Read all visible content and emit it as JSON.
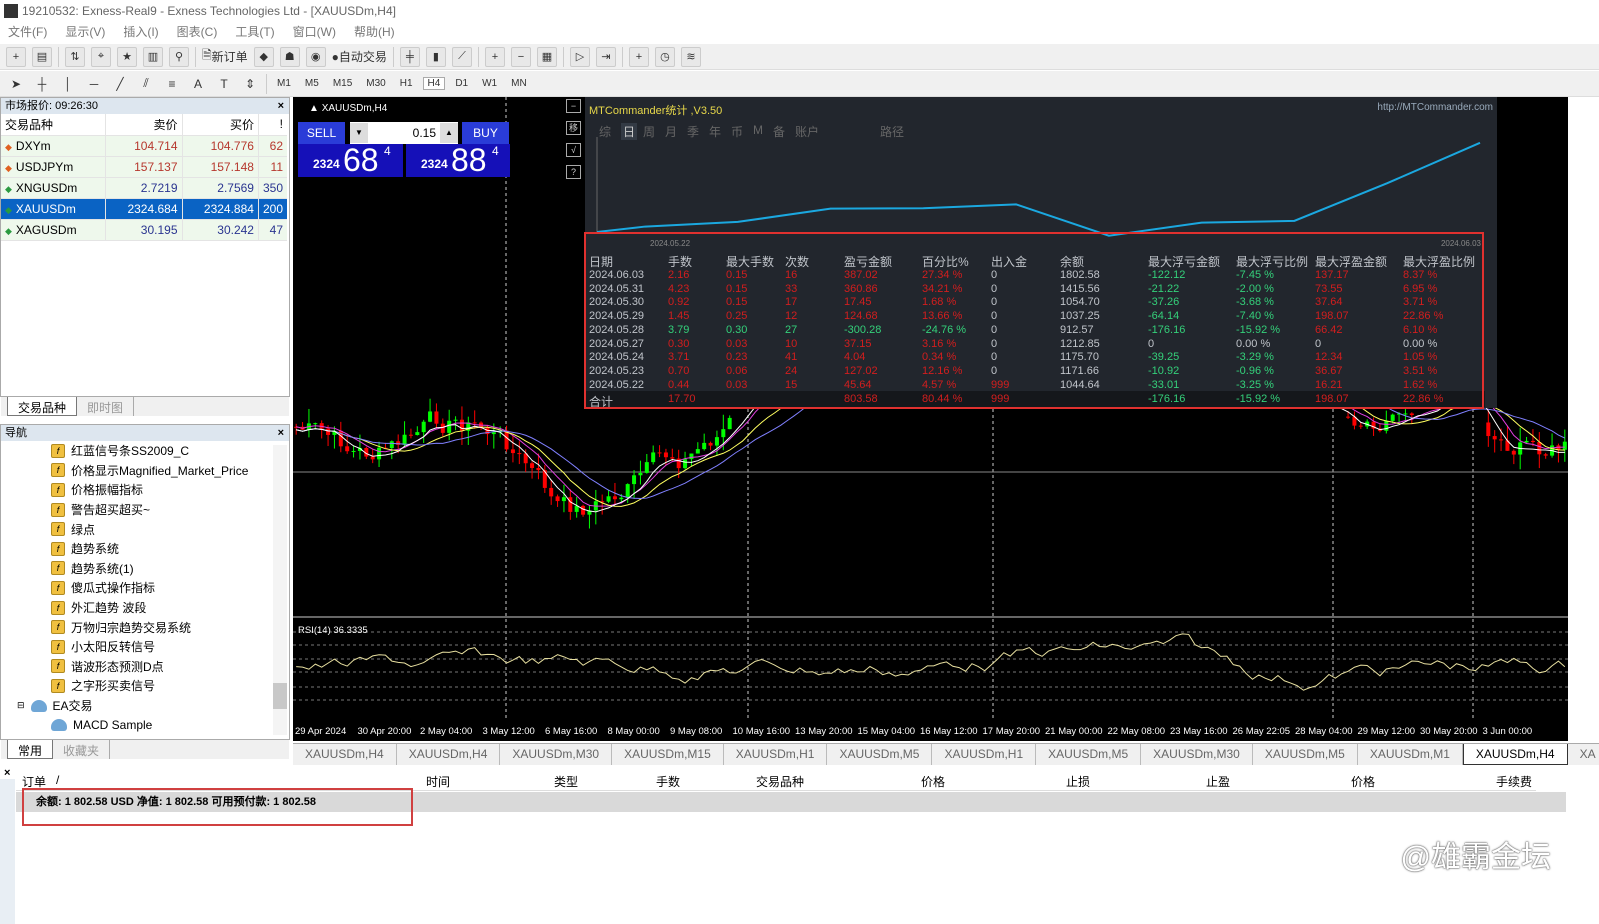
{
  "window": {
    "title": "19210532: Exness-Real9 - Exness Technologies Ltd - [XAUUSDm,H4]"
  },
  "menu": [
    "文件(F)",
    "显示(V)",
    "插入(I)",
    "图表(C)",
    "工具(T)",
    "窗口(W)",
    "帮助(H)"
  ],
  "toolbar": {
    "new_order": "新订单",
    "auto_trade": "自动交易"
  },
  "timeframes": [
    "M1",
    "M5",
    "M15",
    "M30",
    "H1",
    "H4",
    "D1",
    "W1",
    "MN"
  ],
  "active_timeframe": "H4",
  "market_watch": {
    "title": "市场报价: 09:26:30",
    "headers": [
      "交易品种",
      "卖价",
      "买价",
      "!"
    ],
    "rows": [
      {
        "symbol": "DXYm",
        "bid": "104.714",
        "ask": "104.776",
        "spread": "62",
        "dir": "down"
      },
      {
        "symbol": "USDJPYm",
        "bid": "157.137",
        "ask": "157.148",
        "spread": "11",
        "dir": "down"
      },
      {
        "symbol": "XNGUSDm",
        "bid": "2.7219",
        "ask": "2.7569",
        "spread": "350",
        "dir": "up"
      },
      {
        "symbol": "XAUUSDm",
        "bid": "2324.684",
        "ask": "2324.884",
        "spread": "200",
        "dir": "up",
        "selected": true
      },
      {
        "symbol": "XAGUSDm",
        "bid": "30.195",
        "ask": "30.242",
        "spread": "47",
        "dir": "up"
      }
    ],
    "tabs": [
      "交易品种",
      "即时图"
    ]
  },
  "navigator": {
    "title": "导航",
    "items": [
      "红蓝信号条SS2009_C",
      "价格显示Magnified_Market_Price",
      "价格振幅指标",
      "警告超买超买~",
      "绿点",
      "趋势系统",
      "趋势系统(1)",
      "傻瓜式操作指标",
      "外汇趋势 波段",
      "万物归宗趋势交易系统",
      "小太阳反转信号",
      "谐波形态预测D点",
      "之字形买卖信号"
    ],
    "ea_folder": "EA交易",
    "ea_item": "MACD Sample",
    "tabs": [
      "常用",
      "收藏夹"
    ]
  },
  "chart": {
    "label": "XAUUSDm,H4",
    "sell": "SELL",
    "buy": "BUY",
    "lot": "0.15",
    "bid_prefix": "2324",
    "bid_big": "68",
    "bid_sup": "4",
    "ask_prefix": "2324",
    "ask_big": "88",
    "ask_sup": "4",
    "rsi_label": "RSI(14) 36.3335",
    "time_axis": [
      "29 Apr 2024",
      "30 Apr 20:00",
      "2 May 04:00",
      "3 May 12:00",
      "6 May 16:00",
      "8 May 00:00",
      "9 May 08:00",
      "10 May 16:00",
      "13 May 20:00",
      "15 May 04:00",
      "16 May 12:00",
      "17 May 20:00",
      "21 May 00:00",
      "22 May 08:00",
      "23 May 16:00",
      "26 May 22:05",
      "28 May 04:00",
      "29 May 12:00",
      "30 May 20:00",
      "3 Jun 00:00"
    ]
  },
  "stats": {
    "title": "MTCommander统计 ,V3.50",
    "url": "http://MTCommander.com",
    "tabs": [
      "综",
      "日",
      "周",
      "月",
      "季",
      "年",
      "币",
      "M",
      "备",
      "账户",
      "路径"
    ],
    "active_tab": "日",
    "side_buttons": [
      "−",
      "移",
      "√",
      "?"
    ],
    "curve_start": "2024.05.22",
    "curve_end": "2024.06.03",
    "headers": [
      "日期",
      "手数",
      "最大手数",
      "次数",
      "盈亏金额",
      "百分比%",
      "出入金",
      "余额",
      "最大浮亏金额",
      "最大浮亏比例",
      "最大浮盈金额",
      "最大浮盈比例"
    ],
    "rows": [
      [
        "2024.06.03",
        "2.16",
        "0.15",
        "16",
        "387.02",
        "27.34 %",
        "0",
        "1802.58",
        "-122.12",
        "-7.45 %",
        "137.17",
        "8.37 %"
      ],
      [
        "2024.05.31",
        "4.23",
        "0.15",
        "33",
        "360.86",
        "34.21 %",
        "0",
        "1415.56",
        "-21.22",
        "-2.00 %",
        "73.55",
        "6.95 %"
      ],
      [
        "2024.05.30",
        "0.92",
        "0.15",
        "17",
        "17.45",
        "1.68 %",
        "0",
        "1054.70",
        "-37.26",
        "-3.68 %",
        "37.64",
        "3.71 %"
      ],
      [
        "2024.05.29",
        "1.45",
        "0.25",
        "12",
        "124.68",
        "13.66 %",
        "0",
        "1037.25",
        "-64.14",
        "-7.40 %",
        "198.07",
        "22.86 %"
      ],
      [
        "2024.05.28",
        "3.79",
        "0.30",
        "27",
        "-300.28",
        "-24.76 %",
        "0",
        "912.57",
        "-176.16",
        "-15.92 %",
        "66.42",
        "6.10 %"
      ],
      [
        "2024.05.27",
        "0.30",
        "0.03",
        "10",
        "37.15",
        "3.16 %",
        "0",
        "1212.85",
        "0",
        "0.00 %",
        "0",
        "0.00 %"
      ],
      [
        "2024.05.24",
        "3.71",
        "0.23",
        "41",
        "4.04",
        "0.34 %",
        "0",
        "1175.70",
        "-39.25",
        "-3.29 %",
        "12.34",
        "1.05 %"
      ],
      [
        "2024.05.23",
        "0.70",
        "0.06",
        "24",
        "127.02",
        "12.16 %",
        "0",
        "1171.66",
        "-10.92",
        "-0.96 %",
        "36.67",
        "3.51 %"
      ],
      [
        "2024.05.22",
        "0.44",
        "0.03",
        "15",
        "45.64",
        "4.57 %",
        "999",
        "1044.64",
        "-33.01",
        "-3.25 %",
        "16.21",
        "1.62 %"
      ]
    ],
    "total": [
      "合计",
      "17.70",
      "",
      "",
      "803.58",
      "80.44 %",
      "999",
      "",
      "-176.16",
      "-15.92 %",
      "198.07",
      "22.86 %"
    ]
  },
  "chart_tabs": [
    "XAUUSDm,H4",
    "XAUUSDm,H4",
    "XAUUSDm,M30",
    "XAUUSDm,M15",
    "XAUUSDm,H1",
    "XAUUSDm,M5",
    "XAUUSDm,H1",
    "XAUUSDm,M5",
    "XAUUSDm,M30",
    "XAUUSDm,M5",
    "XAUUSDm,M1",
    "XAUUSDm,H4",
    "XA"
  ],
  "terminal": {
    "headers": [
      "订单",
      "/",
      "时间",
      "类型",
      "手数",
      "交易品种",
      "价格",
      "止损",
      "止盈",
      "价格",
      "手续费"
    ],
    "balance": "余额: 1 802.58 USD  净值: 1 802.58  可用预付款: 1 802.58"
  },
  "watermark": "@雄霸金坛"
}
